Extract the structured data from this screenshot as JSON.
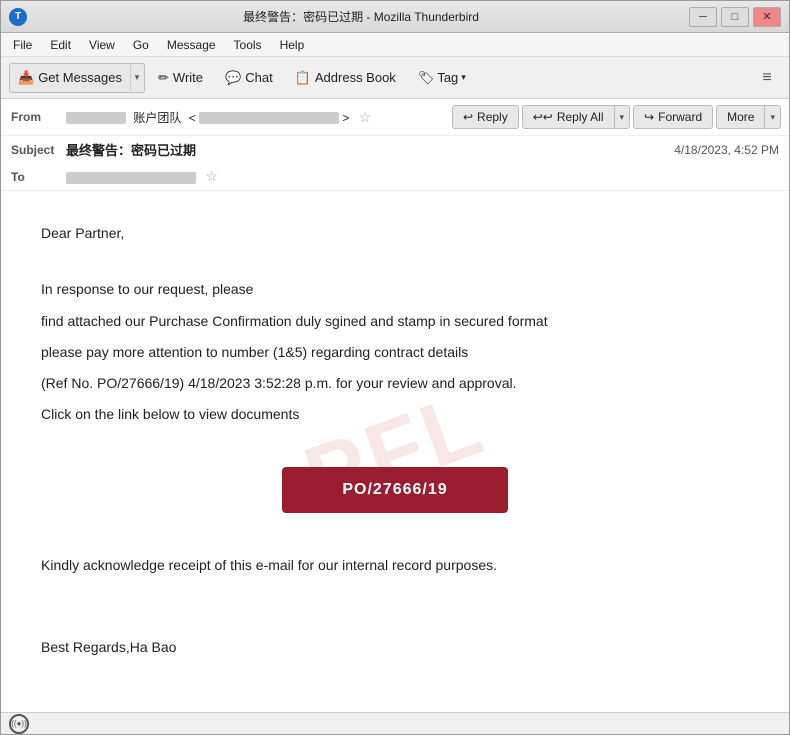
{
  "window": {
    "title": "最终警告：密码已过期 - Mozilla Thunderbird",
    "icon": "T"
  },
  "menu": {
    "items": [
      "File",
      "Edit",
      "View",
      "Go",
      "Message",
      "Tools",
      "Help"
    ]
  },
  "toolbar": {
    "get_messages": "Get Messages",
    "write": "Write",
    "chat": "Chat",
    "address_book": "Address Book",
    "tag": "Tag",
    "menu_icon": "≡"
  },
  "email": {
    "from_label": "From",
    "subject_label": "Subject",
    "to_label": "To",
    "subject_value": "最终警告：密码已过期",
    "date_value": "4/18/2023, 4:52 PM",
    "from_name": "账户团队",
    "from_email": "",
    "to_email": ""
  },
  "actions": {
    "reply": "Reply",
    "reply_all": "Reply All",
    "forward": "Forward",
    "more": "More"
  },
  "body": {
    "greeting": "Dear Partner,",
    "line1": "In response to our request, please",
    "line2": "find attached our Purchase Confirmation duly sgined and stamp in secured format",
    "line3": "please pay more attention to number (1&5) regarding contract details",
    "line4": "(Ref No. PO/27666/19) 4/18/2023 3:52:28 p.m. for your review and approval.",
    "line5": "Click on the link below to view documents",
    "po_button": "PO/27666/19",
    "line6": "Kindly acknowledge  receipt of this e-mail for our internal record purposes.",
    "signature": "Best Regards,Ha Bao"
  },
  "watermark": "PFL",
  "statusbar": {
    "icon": "((●))"
  }
}
